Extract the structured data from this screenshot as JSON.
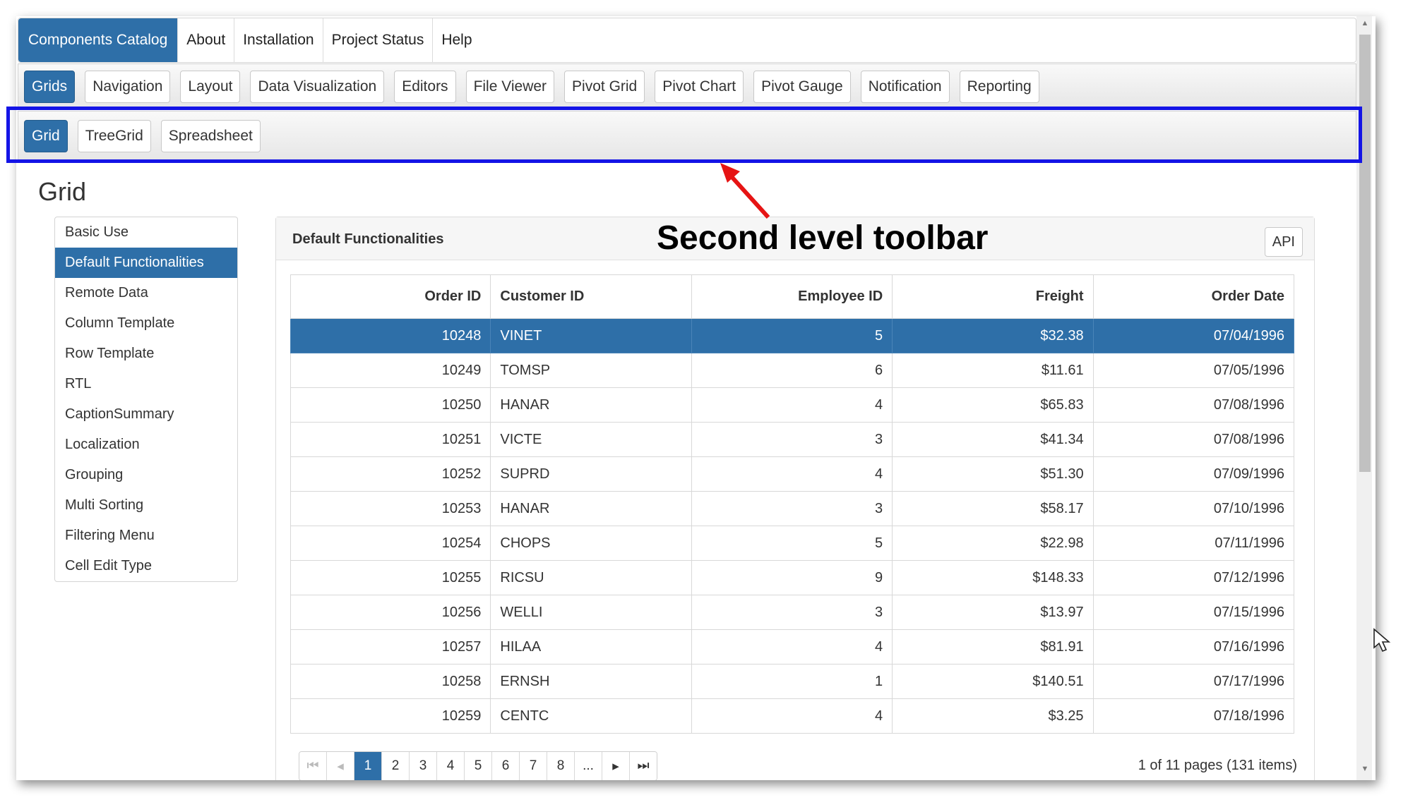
{
  "top_nav": {
    "items": [
      {
        "label": "Components Catalog",
        "active": true
      },
      {
        "label": "About"
      },
      {
        "label": "Installation"
      },
      {
        "label": "Project Status"
      },
      {
        "label": "Help"
      }
    ]
  },
  "toolbar1": {
    "items": [
      "Grids",
      "Navigation",
      "Layout",
      "Data Visualization",
      "Editors",
      "File Viewer",
      "Pivot Grid",
      "Pivot Chart",
      "Pivot Gauge",
      "Notification",
      "Reporting"
    ]
  },
  "toolbar2": {
    "items": [
      "Grid",
      "TreeGrid",
      "Spreadsheet"
    ]
  },
  "annotation": "Second level toolbar",
  "page_title": "Grid",
  "sidebar": {
    "items": [
      "Basic Use",
      "Default Functionalities",
      "Remote Data",
      "Column Template",
      "Row Template",
      "RTL",
      "CaptionSummary",
      "Localization",
      "Grouping",
      "Multi Sorting",
      "Filtering Menu",
      "Cell Edit Type"
    ]
  },
  "panel": {
    "title": "Default Functionalities",
    "api_label": "API"
  },
  "grid": {
    "columns": [
      "Order ID",
      "Customer ID",
      "Employee ID",
      "Freight",
      "Order Date"
    ],
    "rows": [
      [
        "10248",
        "VINET",
        "5",
        "$32.38",
        "07/04/1996"
      ],
      [
        "10249",
        "TOMSP",
        "6",
        "$11.61",
        "07/05/1996"
      ],
      [
        "10250",
        "HANAR",
        "4",
        "$65.83",
        "07/08/1996"
      ],
      [
        "10251",
        "VICTE",
        "3",
        "$41.34",
        "07/08/1996"
      ],
      [
        "10252",
        "SUPRD",
        "4",
        "$51.30",
        "07/09/1996"
      ],
      [
        "10253",
        "HANAR",
        "3",
        "$58.17",
        "07/10/1996"
      ],
      [
        "10254",
        "CHOPS",
        "5",
        "$22.98",
        "07/11/1996"
      ],
      [
        "10255",
        "RICSU",
        "9",
        "$148.33",
        "07/12/1996"
      ],
      [
        "10256",
        "WELLI",
        "3",
        "$13.97",
        "07/15/1996"
      ],
      [
        "10257",
        "HILAA",
        "4",
        "$81.91",
        "07/16/1996"
      ],
      [
        "10258",
        "ERNSH",
        "1",
        "$140.51",
        "07/17/1996"
      ],
      [
        "10259",
        "CENTC",
        "4",
        "$3.25",
        "07/18/1996"
      ]
    ]
  },
  "pager": {
    "pages": [
      "1",
      "2",
      "3",
      "4",
      "5",
      "6",
      "7",
      "8",
      "..."
    ],
    "info": "1 of 11 pages (131 items)"
  },
  "colors": {
    "accent": "#2e6fa8",
    "highlight_box": "#1414e6",
    "annotation_arrow": "#e61414"
  }
}
